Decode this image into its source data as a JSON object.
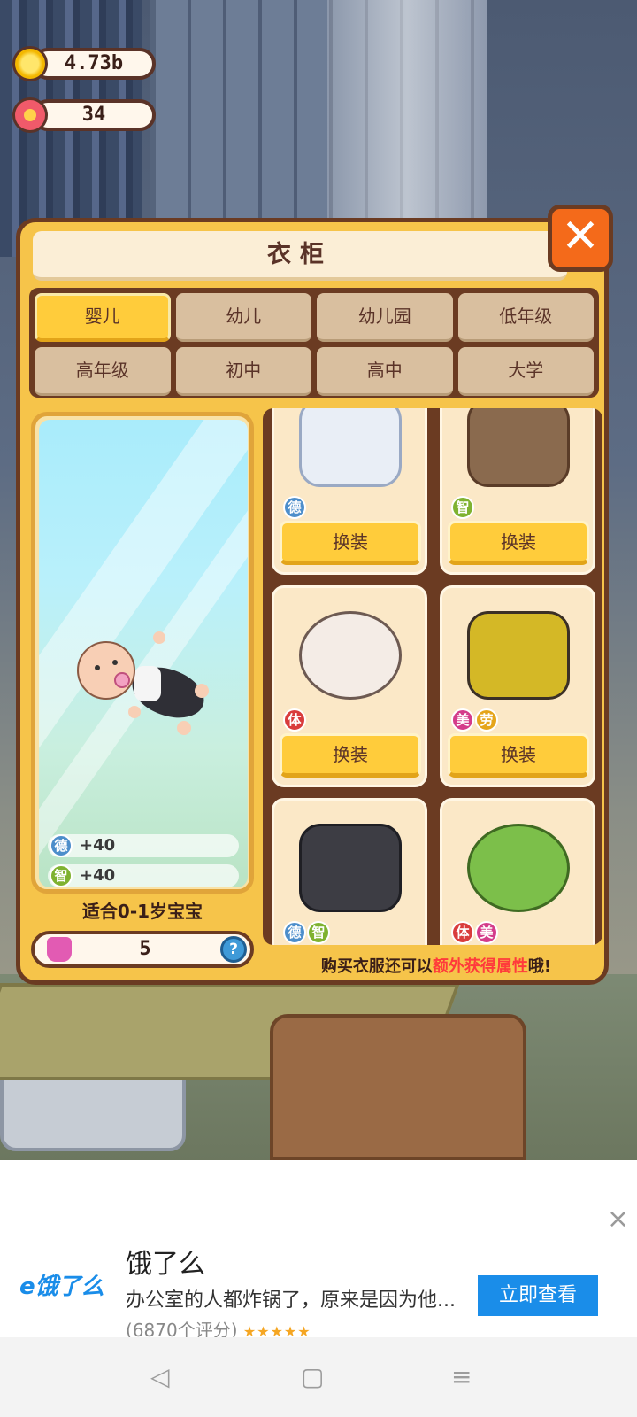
{
  "stats": {
    "coins": "4.73b",
    "flowers": "34"
  },
  "wardrobe": {
    "title": "衣柜",
    "tabs": [
      "婴儿",
      "幼儿",
      "幼儿园",
      "低年级",
      "高年级",
      "初中",
      "高中",
      "大学"
    ],
    "active_tab": "婴儿",
    "preview": {
      "attributes": [
        {
          "badge": "德",
          "value": "+40"
        },
        {
          "badge": "智",
          "value": "+40"
        }
      ],
      "age_label": "适合0-1岁宝宝",
      "shop_count": "5",
      "help_label": "?"
    },
    "items": [
      {
        "badges": [
          "德"
        ],
        "button": "换装",
        "color": "#e9eef6"
      },
      {
        "badges": [
          "智"
        ],
        "button": "换装",
        "color": "#8a6a4e"
      },
      {
        "badges": [
          "体"
        ],
        "button": "换装",
        "color": "#f4ece6"
      },
      {
        "badges": [
          "美",
          "劳"
        ],
        "button": "换装",
        "color": "#d4b826"
      },
      {
        "badges": [
          "德",
          "智"
        ],
        "button": "",
        "color": "#3d3d44"
      },
      {
        "badges": [
          "体",
          "美"
        ],
        "button": "",
        "color": "#7cbf4a"
      }
    ],
    "hint": {
      "prefix": "购买衣服还可以",
      "highlight": "额外获得属性",
      "suffix": "哦!"
    }
  },
  "ad": {
    "logo": "e饿了么",
    "title": "饿了么",
    "description": "办公室的人都炸锅了，原来是因为他...",
    "rating": "(6870个评分)",
    "stars": "★★★★★",
    "cta": "立即查看",
    "close": "×"
  },
  "navbar": {
    "back": "◁",
    "home": "▢",
    "menu": "≡"
  }
}
